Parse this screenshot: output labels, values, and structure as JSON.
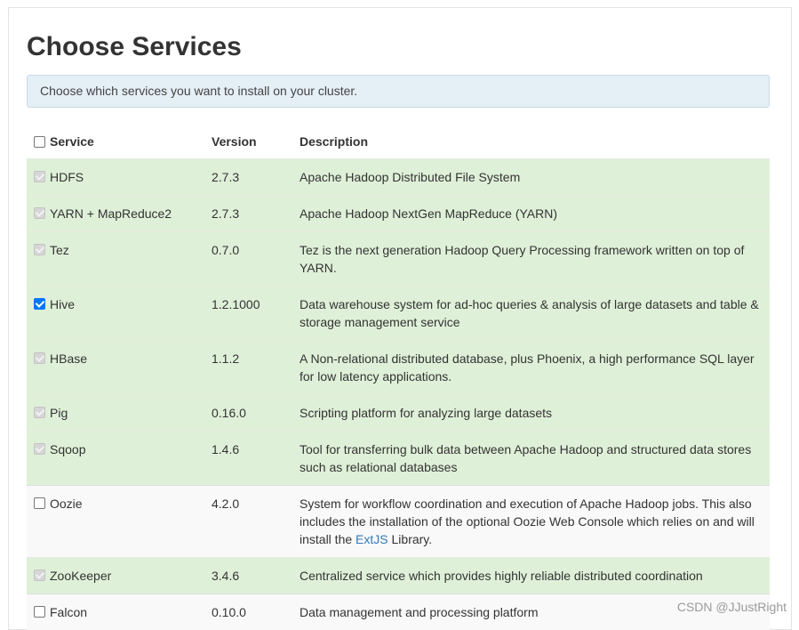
{
  "page": {
    "title": "Choose Services",
    "info": "Choose which services you want to install on your cluster."
  },
  "table": {
    "headers": {
      "service": "Service",
      "version": "Version",
      "description": "Description"
    },
    "rows": [
      {
        "service": "HDFS",
        "version": "2.7.3",
        "description": "Apache Hadoop Distributed File System",
        "checked": true,
        "disabled": true
      },
      {
        "service": "YARN + MapReduce2",
        "version": "2.7.3",
        "description": "Apache Hadoop NextGen MapReduce (YARN)",
        "checked": true,
        "disabled": true
      },
      {
        "service": "Tez",
        "version": "0.7.0",
        "description": "Tez is the next generation Hadoop Query Processing framework written on top of YARN.",
        "checked": true,
        "disabled": true
      },
      {
        "service": "Hive",
        "version": "1.2.1000",
        "description": "Data warehouse system for ad-hoc queries & analysis of large datasets and table & storage management service",
        "checked": true,
        "disabled": false
      },
      {
        "service": "HBase",
        "version": "1.1.2",
        "description": "A Non-relational distributed database, plus Phoenix, a high performance SQL layer for low latency applications.",
        "checked": true,
        "disabled": true
      },
      {
        "service": "Pig",
        "version": "0.16.0",
        "description": "Scripting platform for analyzing large datasets",
        "checked": true,
        "disabled": true
      },
      {
        "service": "Sqoop",
        "version": "1.4.6",
        "description": "Tool for transferring bulk data between Apache Hadoop and structured data stores such as relational databases",
        "checked": true,
        "disabled": true
      },
      {
        "service": "Oozie",
        "version": "4.2.0",
        "description_pre": "System for workflow coordination and execution of Apache Hadoop jobs. This also includes the installation of the optional Oozie Web Console which relies on and will install the ",
        "description_link": "ExtJS",
        "description_post": " Library.",
        "checked": false,
        "disabled": false
      },
      {
        "service": "ZooKeeper",
        "version": "3.4.6",
        "description": "Centralized service which provides highly reliable distributed coordination",
        "checked": true,
        "disabled": true
      },
      {
        "service": "Falcon",
        "version": "0.10.0",
        "description": "Data management and processing platform",
        "checked": false,
        "disabled": false
      }
    ]
  },
  "watermark": "CSDN @JJustRight",
  "colors": {
    "selected_row": "#dff0d8",
    "link": "#337ab7",
    "checkbox_checked": "#0075ff"
  }
}
